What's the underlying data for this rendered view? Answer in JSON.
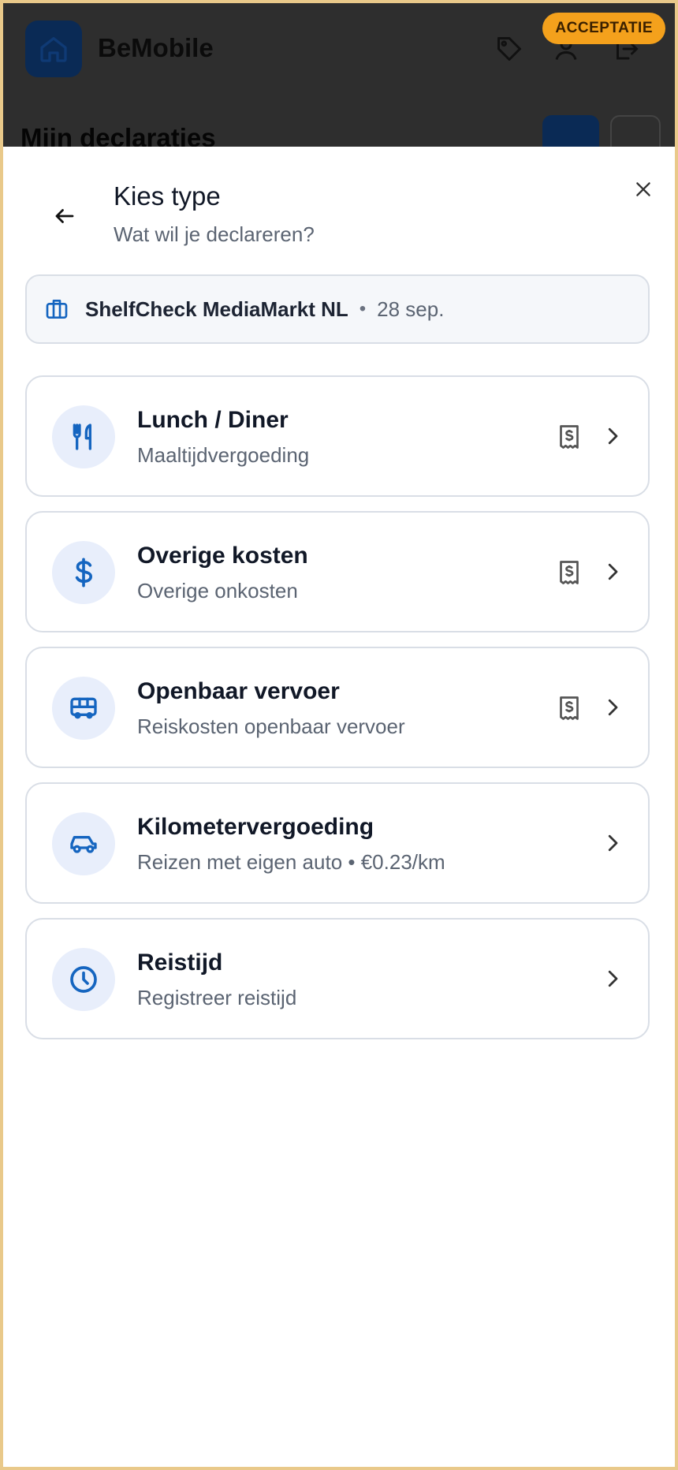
{
  "app": {
    "name": "BeMobile",
    "environment_badge": "ACCEPTATIE",
    "page_title": "Mijn declaraties"
  },
  "sheet": {
    "title": "Kies type",
    "subtitle": "Wat wil je declareren?",
    "context": {
      "project": "ShelfCheck MediaMarkt NL",
      "separator": "•",
      "date": "28 sep."
    },
    "types": [
      {
        "label": "Lunch / Diner",
        "description": "Maaltijdvergoeding",
        "icon": "utensils-icon",
        "receipt": true
      },
      {
        "label": "Overige kosten",
        "description": "Overige onkosten",
        "icon": "dollar-icon",
        "receipt": true
      },
      {
        "label": "Openbaar vervoer",
        "description": "Reiskosten openbaar vervoer",
        "icon": "bus-icon",
        "receipt": true
      },
      {
        "label": "Kilometervergoeding",
        "description": "Reizen met eigen auto • €0.23/km",
        "icon": "car-icon",
        "receipt": false
      },
      {
        "label": "Reistijd",
        "description": "Registreer reistijd",
        "icon": "clock-icon",
        "receipt": false
      }
    ]
  },
  "colors": {
    "accent": "#1565c0",
    "badge": "#f4a11c",
    "icon_bg": "#e8eefb",
    "border": "#d9dee6"
  }
}
